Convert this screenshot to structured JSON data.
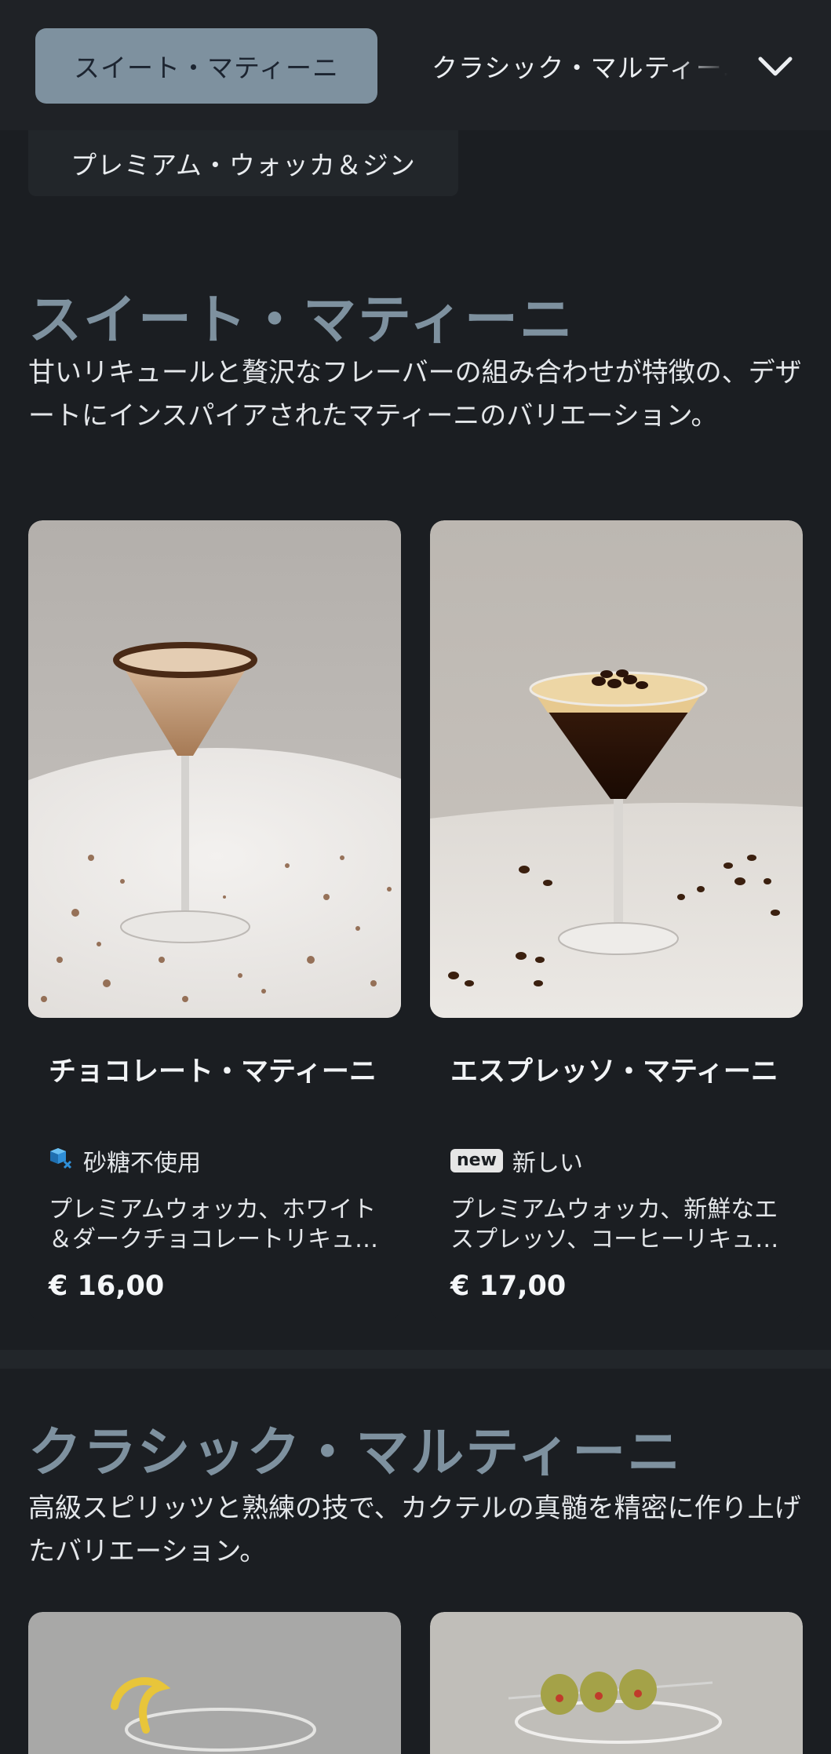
{
  "nav": {
    "active_category": "スイート・マティーニ",
    "next_category": "クラシック・マルティーニ",
    "second_row_category": "プレミアム・ウォッカ＆ジン"
  },
  "sections": [
    {
      "title": "スイート・マティーニ",
      "description": "甘いリキュールと贅沢なフレーバーの組み合わせが特徴の、デザートにインスパイアされたマティーニのバリエーション。",
      "items": [
        {
          "name": "チョコレート・マティーニ",
          "tag_icon": "sugar-free-icon",
          "tag": "砂糖不使用",
          "description": "プレミアムウォッカ、ホワイト＆ダークチョコレートリキュール",
          "price": "€ 16,00"
        },
        {
          "name": "エスプレッソ・マティーニ",
          "tag_badge": "new",
          "tag": "新しい",
          "description": "プレミアムウォッカ、新鮮なエスプレッソ、コーヒーリキュール",
          "price": "€ 17,00"
        }
      ]
    },
    {
      "title": "クラシック・マルティーニ",
      "description": "高級スピリッツと熟練の技で、カクテルの真髄を精密に作り上げたバリエーション。"
    }
  ],
  "colors": {
    "background": "#1b1e22",
    "accent": "#7e919f",
    "active_pill_text": "#1c2430"
  }
}
